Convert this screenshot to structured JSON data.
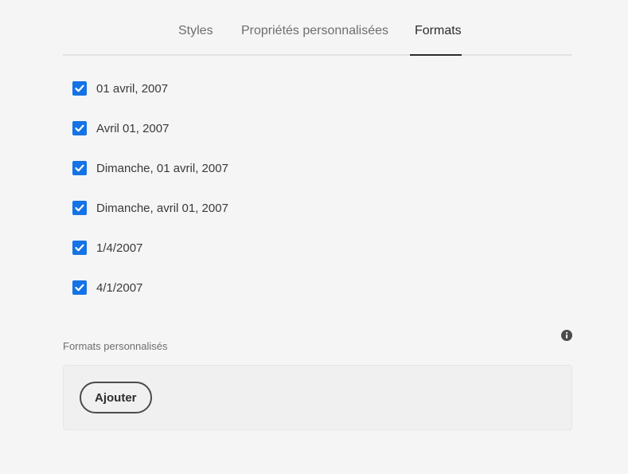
{
  "tabs": [
    {
      "label": "Styles",
      "selected": false
    },
    {
      "label": "Propriétés personnalisées",
      "selected": false
    },
    {
      "label": "Formats",
      "selected": true
    }
  ],
  "formats": [
    {
      "label": "01 avril, 2007",
      "checked": true
    },
    {
      "label": "Avril 01, 2007",
      "checked": true
    },
    {
      "label": "Dimanche, 01 avril, 2007",
      "checked": true
    },
    {
      "label": "Dimanche, avril 01, 2007",
      "checked": true
    },
    {
      "label": "1/4/2007",
      "checked": true
    },
    {
      "label": "4/1/2007",
      "checked": true
    }
  ],
  "custom_formats": {
    "label": "Formats personnalisés",
    "info_icon": "info-icon",
    "add_button_label": "Ajouter"
  },
  "colors": {
    "accent": "#1473e6",
    "background": "#f5f5f5",
    "text": "#2c2c2c"
  }
}
